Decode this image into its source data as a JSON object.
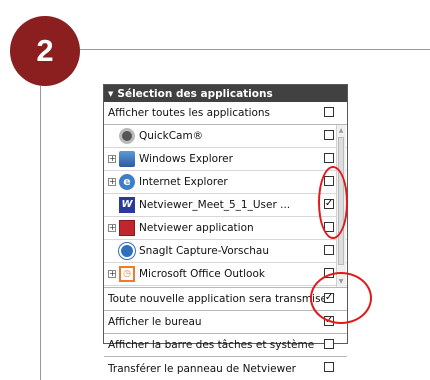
{
  "step_number": "2",
  "panel": {
    "title": "Sélection des applications",
    "show_all_label": "Afficher toutes les applications",
    "show_all_checked": false,
    "apps": [
      {
        "label": "QuickCam®",
        "expander": false,
        "icon": "quickcam-icon",
        "checked": false
      },
      {
        "label": "Windows Explorer",
        "expander": true,
        "icon": "windows-explorer-icon",
        "checked": false
      },
      {
        "label": "Internet Explorer",
        "expander": true,
        "icon": "internet-explorer-icon",
        "checked": false
      },
      {
        "label": "Netviewer_Meet_5_1_User ...",
        "expander": false,
        "icon": "netviewer-meet-icon",
        "checked": true
      },
      {
        "label": "Netviewer application",
        "expander": true,
        "icon": "netviewer-app-icon",
        "checked": false
      },
      {
        "label": "SnagIt Capture-Vorschau",
        "expander": false,
        "icon": "snagit-icon",
        "checked": false
      },
      {
        "label": "Microsoft Office Outlook",
        "expander": true,
        "icon": "outlook-icon",
        "checked": false
      }
    ],
    "options": [
      {
        "label": "Toute nouvelle application sera transmise",
        "checked": true
      },
      {
        "label": "Afficher le bureau",
        "checked": true
      },
      {
        "label": "Afficher la barre des tâches et système",
        "checked": false
      },
      {
        "label": "Transférer le panneau de Netviewer",
        "checked": false
      }
    ]
  },
  "colors": {
    "badge": "#8b1e1e",
    "header": "#414141",
    "annotation": "#e01a1a"
  }
}
